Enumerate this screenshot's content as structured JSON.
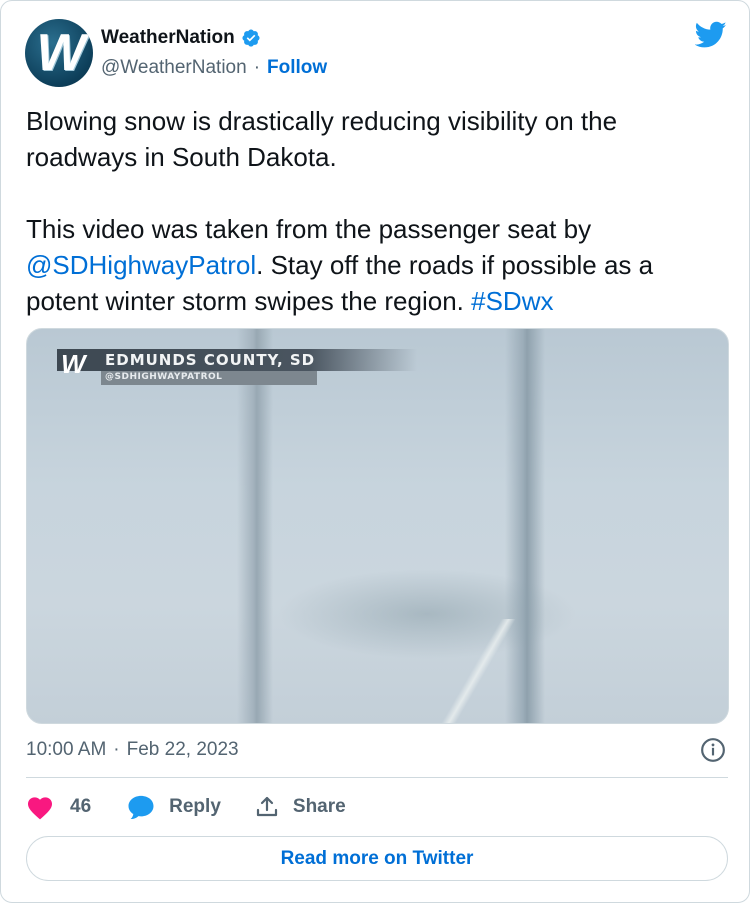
{
  "author": {
    "name": "WeatherNation",
    "handle": "@WeatherNation",
    "separator": "·",
    "follow_label": "Follow",
    "avatar_letter": "W",
    "verified": true
  },
  "tweet": {
    "line1": "Blowing snow is drastically reducing visibility on the roadways in South Dakota.",
    "line2_prefix": "This video was taken from the passenger seat by ",
    "mention": "@SDHighwayPatrol",
    "line2_suffix": ". Stay off the roads if possible as a potent winter storm swipes the region. ",
    "hashtag": "#SDwx"
  },
  "video": {
    "logo_letter": "W",
    "location_title": "EDMUNDS COUNTY, SD",
    "credit": "@SDHIGHWAYPATROL"
  },
  "meta": {
    "time": "10:00 AM",
    "separator": "·",
    "date": "Feb 22, 2023"
  },
  "actions": {
    "like_count": "46",
    "reply_label": "Reply",
    "share_label": "Share"
  },
  "read_more_label": "Read more on Twitter",
  "colors": {
    "link": "#006fd6",
    "like": "#f91880",
    "twitter_blue": "#1d9bf0",
    "muted": "#536471"
  },
  "icons": [
    "verified-badge-icon",
    "twitter-bird-icon",
    "info-icon",
    "heart-icon",
    "reply-bubble-icon",
    "share-icon"
  ]
}
